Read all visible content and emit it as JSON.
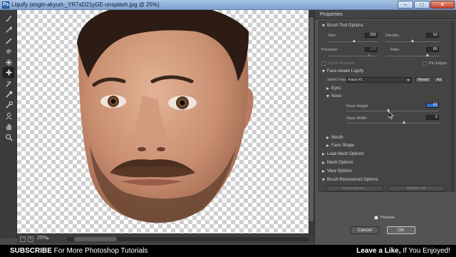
{
  "window": {
    "title": "Liquify (engin-akyurt-_YR7sD21yGE-unsplash.jpg @ 25%)",
    "controls": [
      "–",
      "□",
      "✕"
    ]
  },
  "tools": [
    {
      "icon": "forward-warp-icon",
      "active": false
    },
    {
      "icon": "reconstruct-icon",
      "active": false
    },
    {
      "icon": "smooth-icon",
      "active": false
    },
    {
      "icon": "twirl-icon",
      "active": false
    },
    {
      "icon": "pucker-icon",
      "active": false
    },
    {
      "icon": "bloat-icon",
      "active": false
    },
    {
      "icon": "face-tool-icon",
      "active": true
    },
    {
      "icon": "push-left-icon",
      "active": false
    },
    {
      "icon": "freeze-mask-icon",
      "active": false
    },
    {
      "icon": "thaw-mask-icon",
      "active": false
    },
    {
      "icon": "face-icon",
      "active": false
    },
    {
      "icon": "hand-icon",
      "active": false
    },
    {
      "icon": "zoom-icon",
      "active": false
    }
  ],
  "status": {
    "zoom": "25%",
    "zoom_out": "−",
    "zoom_in": "+"
  },
  "panel": {
    "header": "Properties",
    "brush_tool_options": {
      "title": "Brush Tool Options",
      "size_label": "Size:",
      "size_value": "395",
      "density_label": "Density:",
      "density_value": "50",
      "pressure_label": "Pressure:",
      "pressure_value": "100",
      "rate_label": "Rate:",
      "rate_value": "80",
      "stylus_pressure_label": "Stylus Pressure",
      "pin_edges_label": "Pin Edges"
    },
    "face_aware": {
      "title": "Face-Aware Liquify",
      "select_face_label": "Select Face:",
      "select_face_value": "Face #1",
      "reset_label": "Reset",
      "all_label": "All",
      "eyes_label": "Eyes",
      "nose_label": "Nose",
      "nose_height_label": "Nose Height:",
      "nose_height_value": "62",
      "nose_width_label": "Nose Width:",
      "nose_width_value": "0",
      "mouth_label": "Mouth",
      "face_shape_label": "Face Shape"
    },
    "load_mesh_label": "Load Mesh Options",
    "mask_options_label": "Mask Options",
    "view_options_label": "View Options",
    "brush_reconstruct": {
      "title": "Brush Reconstruct Options",
      "reconstruct_label": "Reconstruct...",
      "restore_all_label": "Restore All"
    },
    "preview_label": "Preview",
    "cancel_label": "Cancel",
    "ok_label": "OK"
  },
  "banner": {
    "subscribe": "SUBSCRIBE",
    "subscribe_rest": " For More Photoshop Tutorials",
    "like": "Leave a Like,",
    "like_rest": " If You Enjoyed!"
  }
}
